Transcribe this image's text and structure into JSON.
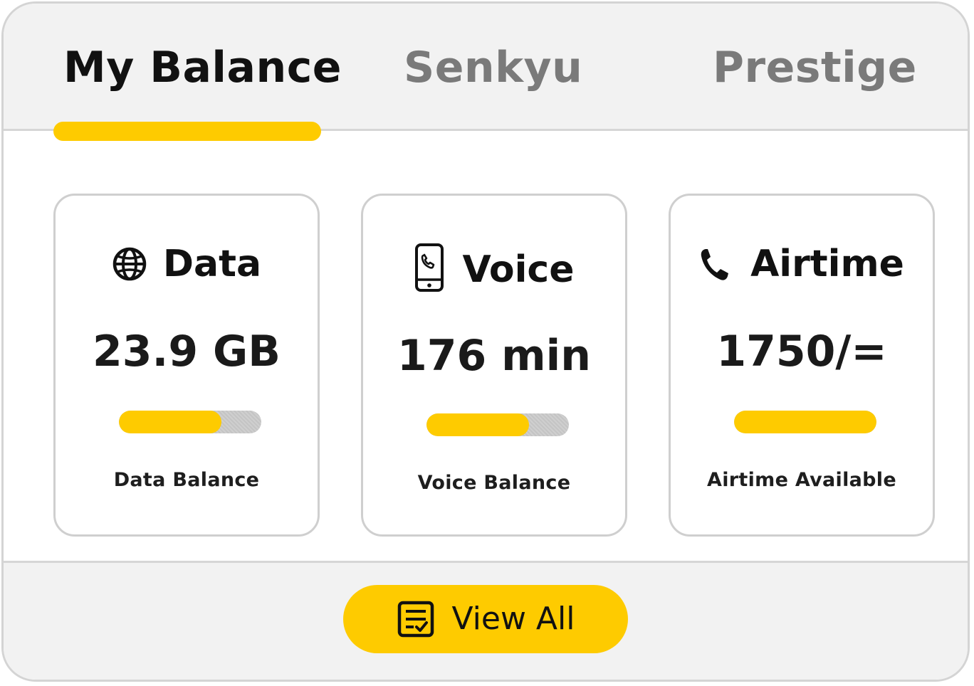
{
  "tabs": [
    {
      "label": "My Balance",
      "active": true
    },
    {
      "label": "Senkyu",
      "active": false
    },
    {
      "label": "Prestige",
      "active": false
    }
  ],
  "tiles": [
    {
      "icon": "globe-icon",
      "title": "Data",
      "value": "23.9 GB",
      "progress": 0.72,
      "caption": "Data Balance"
    },
    {
      "icon": "mobile-phone-icon",
      "title": "Voice",
      "value": "176 min",
      "progress": 0.72,
      "caption": "Voice Balance"
    },
    {
      "icon": "phone-handset-icon",
      "title": "Airtime",
      "value": "1750/=",
      "progress": 1.0,
      "caption": "Airtime Available"
    }
  ],
  "footer": {
    "button_label": "View All",
    "button_icon": "checklist-icon"
  },
  "colors": {
    "accent": "#fecb00",
    "active_text": "#111111",
    "inactive_text": "#7a7a7a",
    "panel_bg": "#f2f2f2",
    "border": "#cfcfcf"
  }
}
